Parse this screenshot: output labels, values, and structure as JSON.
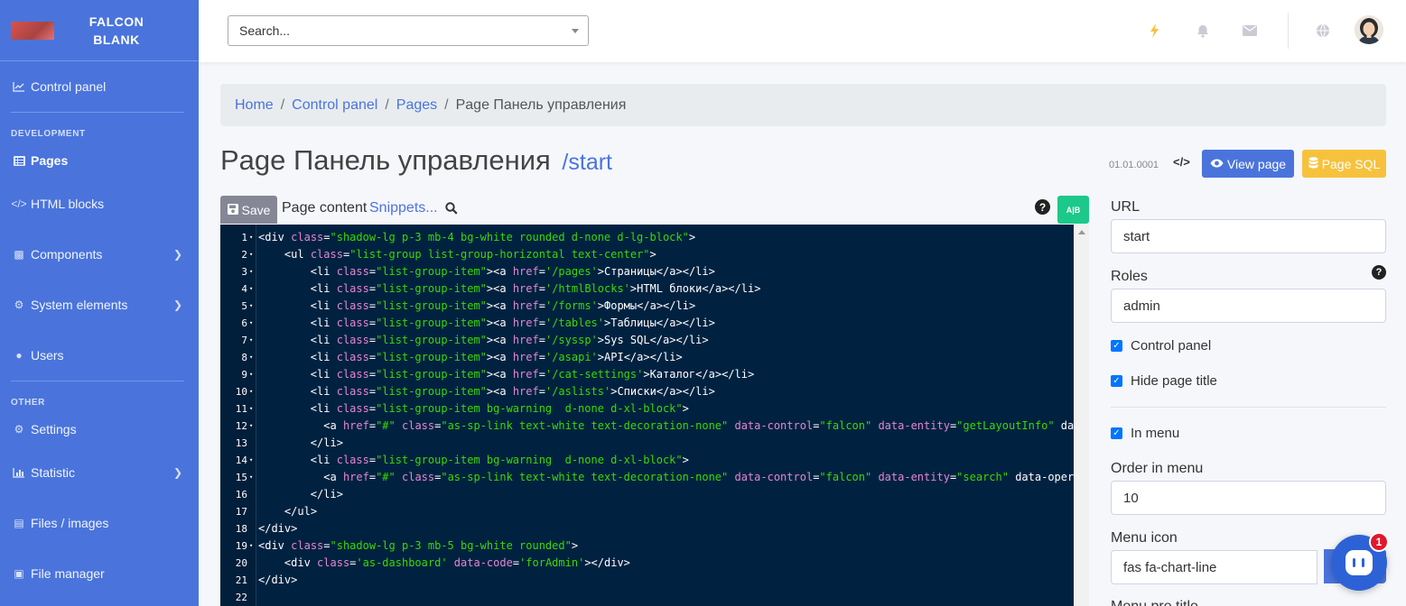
{
  "brand": {
    "name": "FALCON BLANK"
  },
  "sidebar": {
    "items": [
      {
        "label": "Control panel",
        "icon": "chart-line-icon"
      },
      {
        "label": "Pages",
        "icon": "list-icon",
        "active": true
      },
      {
        "label": "HTML blocks",
        "icon": "code-icon"
      },
      {
        "label": "Components",
        "icon": "cubes-icon",
        "has_children": true
      },
      {
        "label": "System elements",
        "icon": "cogs-icon",
        "has_children": true
      },
      {
        "label": "Users",
        "icon": "users-icon"
      },
      {
        "label": "Settings",
        "icon": "gear-icon"
      },
      {
        "label": "Statistic",
        "icon": "chart-bar-icon",
        "has_children": true
      },
      {
        "label": "Files / images",
        "icon": "images-icon"
      },
      {
        "label": "File manager",
        "icon": "folder-icon"
      }
    ],
    "headings": {
      "development": "DEVELOPMENT",
      "other": "OTHER"
    }
  },
  "topbar": {
    "search_placeholder": "Search...",
    "icons": [
      "bolt-icon",
      "bell-icon",
      "envelope-icon",
      "globe-icon",
      "avatar"
    ]
  },
  "breadcrumb": {
    "items": [
      "Home",
      "Control panel",
      "Pages"
    ],
    "current": "Page Панель управления"
  },
  "page": {
    "title": "Page Панель управления",
    "slug": "/start",
    "version": "01.01.0001",
    "code_label": "</>",
    "view_label": "View page",
    "sql_label": "Page SQL"
  },
  "editor": {
    "save_label": "Save",
    "content_label": "Page content",
    "snippets_label": "Snippets...",
    "toggle_label": "A|B",
    "lines": [
      "<div class=\"shadow-lg p-3 mb-4 bg-white rounded d-none d-lg-block\">",
      "    <ul class=\"list-group list-group-horizontal text-center\">",
      "        <li class=\"list-group-item\"><a href='/pages'>Страницы</a></li>",
      "        <li class=\"list-group-item\"><a href='/htmlBlocks'>HTML блоки</a></li>",
      "        <li class=\"list-group-item\"><a href='/forms'>Формы</a></li>",
      "        <li class=\"list-group-item\"><a href='/tables'>Таблицы</a></li>",
      "        <li class=\"list-group-item\"><a href='/syssp'>Sys SQL</a></li>",
      "        <li class=\"list-group-item\"><a href='/asapi'>API</a></li>",
      "        <li class=\"list-group-item\"><a href='/cat-settings'>Каталог</a></li>",
      "        <li class=\"list-group-item\"><a href='/aslists'>Списки</a></li>",
      "        <li class=\"list-group-item bg-warning  d-none d-xl-block\">",
      "          <a href=\"#\" class=\"as-sp-link text-white text-decoration-none\" data-control=\"falcon\" data-entity=\"getLayoutInfo\" dat",
      "        </li>",
      "        <li class=\"list-group-item bg-warning  d-none d-xl-block\">",
      "          <a href=\"#\" class=\"as-sp-link text-white text-decoration-none\" data-control=\"falcon\" data-entity=\"search\" data-opera",
      "        </li>",
      "    </ul>",
      "</div>",
      "<div class=\"shadow-lg p-3 mb-5 bg-white rounded\">",
      "    <div class='as-dashboard' data-code='forAdmin'></div>",
      "</div>",
      ""
    ],
    "fold_lines": [
      1,
      2,
      3,
      4,
      5,
      6,
      7,
      8,
      9,
      10,
      11,
      12,
      14,
      15,
      19
    ]
  },
  "form": {
    "url_label": "URL",
    "url_value": "start",
    "roles_label": "Roles",
    "roles_value": "admin",
    "control_panel_label": "Control panel",
    "control_panel_checked": true,
    "hide_title_label": "Hide page title",
    "hide_title_checked": true,
    "in_menu_label": "In menu",
    "in_menu_checked": true,
    "order_label": "Order in menu",
    "order_value": "10",
    "menu_icon_label": "Menu icon",
    "menu_icon_value": "fas fa-chart-line",
    "menu_pre_title_label": "Menu pre title"
  },
  "chat": {
    "badge": "1"
  },
  "colors": {
    "sidebar": "#4a74dc",
    "primary": "#4a74dc",
    "warning": "#f6c23e",
    "success": "#1cc88a",
    "editor_bg": "#002240"
  }
}
